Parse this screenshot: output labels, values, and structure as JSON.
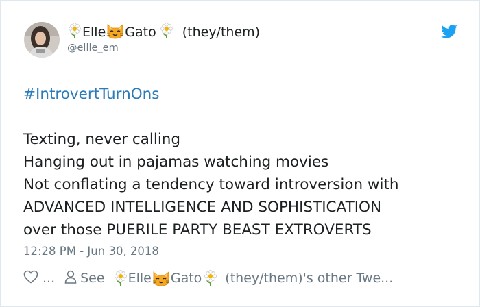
{
  "author": {
    "display_name_part1": "Elle",
    "display_name_part2": "Gato",
    "pronouns": "(they/them)",
    "handle": "@ellle_em"
  },
  "icons": {
    "name_emoji_left": "daisy-flower-icon",
    "name_emoji_middle": "cat-face-icon",
    "name_emoji_right": "daisy-flower-icon",
    "brand": "twitter-bird-icon",
    "like": "heart-outline-icon",
    "profile": "person-outline-icon"
  },
  "tweet": {
    "hashtag": "#IntrovertTurnOns",
    "lines": [
      "Texting, never calling",
      "Hanging out in pajamas watching movies",
      "Not conflating a tendency toward introversion with",
      "ADVANCED INTELLIGENCE AND SOPHISTICATION",
      "over those PUERILE PARTY BEAST EXTROVERTS"
    ],
    "timestamp": "12:28 PM - Jun 30, 2018"
  },
  "actions": {
    "like_count": "...",
    "see_label": "See",
    "see_name_part1": "Elle",
    "see_name_part2": "Gato",
    "see_suffix": "(they/them)'s other Twe..."
  },
  "colors": {
    "link": "#2b7bb9",
    "muted": "#697882",
    "text": "#1c2022",
    "border": "#e1e8ed",
    "twitter_blue": "#1da1f2"
  }
}
